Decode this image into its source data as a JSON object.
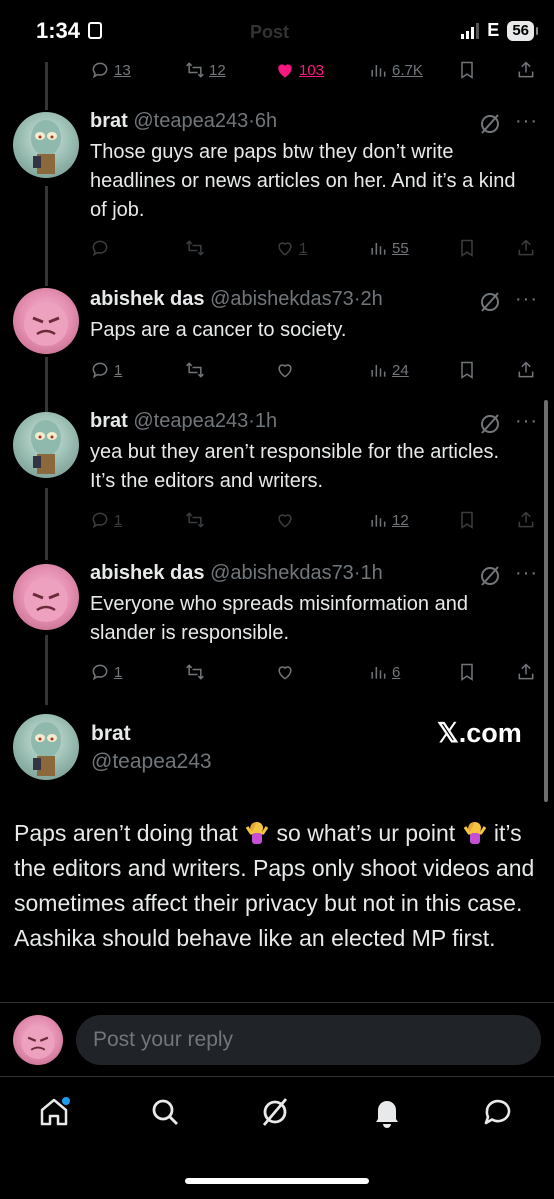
{
  "status_bar": {
    "time": "1:34",
    "network": "E",
    "battery": "56"
  },
  "parent_tweet_actions": {
    "replies": "13",
    "reposts": "12",
    "likes": "103",
    "views": "6.7K"
  },
  "header_title_faded": "Post",
  "tweets": [
    {
      "name": "brat",
      "handle": "@teapea243",
      "time": "6h",
      "text": "Those guys are paps btw they don’t write headlines or news articles on her. And it’s a kind of job.",
      "replies": "",
      "reposts": "",
      "likes": "1",
      "views": "55"
    },
    {
      "name": "abishek das",
      "handle": "@abishekdas73",
      "time": "2h",
      "text": "Paps are a cancer to society.",
      "replies": "1",
      "reposts": "",
      "likes": "",
      "views": "24"
    },
    {
      "name": "brat",
      "handle": "@teapea243",
      "time": "1h",
      "text": "yea but they aren’t responsible for the articles. It’s the editors and writers.",
      "replies": "1",
      "reposts": "",
      "likes": "",
      "views": "12"
    },
    {
      "name": "abishek das",
      "handle": "@abishekdas73",
      "time": "1h",
      "text": "Everyone who spreads misinformation and slander is responsible.",
      "replies": "1",
      "reposts": "",
      "likes": "",
      "views": "6"
    }
  ],
  "focused_tweet": {
    "name": "brat",
    "handle": "@teapea243",
    "brand": "𝕏.com",
    "text_part1": "Paps aren’t doing that ",
    "text_part2": " so what’s ur point ",
    "text_part3": " it’s the editors and writers. Paps only shoot videos and sometimes affect their privacy but not in this case. Aashika should behave like an elected MP first."
  },
  "reply_box": {
    "placeholder": "Post your reply"
  },
  "colors": {
    "background": "#000000",
    "text": "#e7e9ea",
    "muted": "#71767b",
    "like_pink": "#f91880",
    "accent_blue": "#1d9bf0"
  },
  "bottom_nav": [
    "home-icon",
    "search-icon",
    "grok-icon",
    "notifications-icon",
    "messages-icon"
  ]
}
